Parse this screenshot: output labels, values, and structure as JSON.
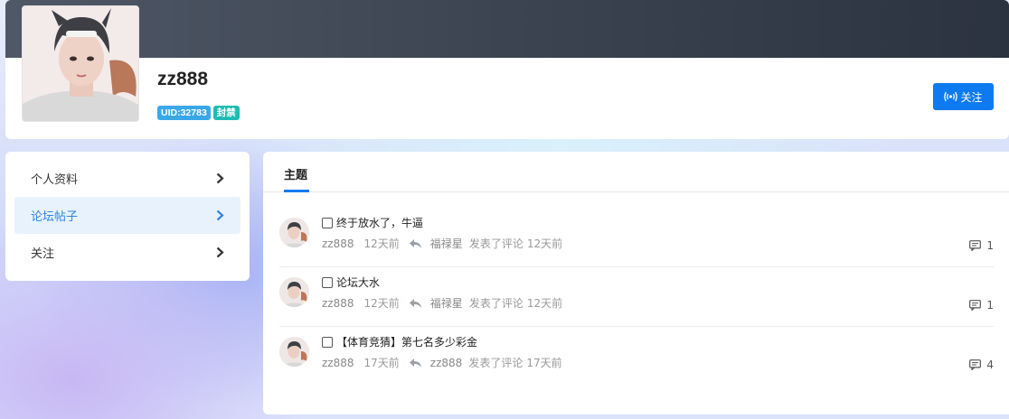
{
  "profile": {
    "username": "zz888",
    "uid_badge": "UID:32783",
    "status_badge": "封禁",
    "follow_label": "关注"
  },
  "sidebar": {
    "items": [
      {
        "label": "个人资料"
      },
      {
        "label": "论坛帖子"
      },
      {
        "label": "关注"
      }
    ]
  },
  "main": {
    "tab_label": "主题",
    "posts": [
      {
        "title": "终于放水了，牛逼",
        "author": "zz888",
        "time": "12天前",
        "replier": "福禄星",
        "action": "发表了评论",
        "reply_time": "12天前",
        "replies": "1"
      },
      {
        "title": "论坛大水",
        "author": "zz888",
        "time": "12天前",
        "replier": "福禄星",
        "action": "发表了评论",
        "reply_time": "12天前",
        "replies": "1"
      },
      {
        "title": "【体育竞猜】第七名多少彩金",
        "author": "zz888",
        "time": "17天前",
        "replier": "zz888",
        "action": "发表了评论",
        "reply_time": "17天前",
        "replies": "4"
      }
    ]
  },
  "colors": {
    "accent": "#0d7aef",
    "uid_badge": "#3aa7e8",
    "banned_badge": "#1dbcb3",
    "banner": "#3c4451"
  }
}
